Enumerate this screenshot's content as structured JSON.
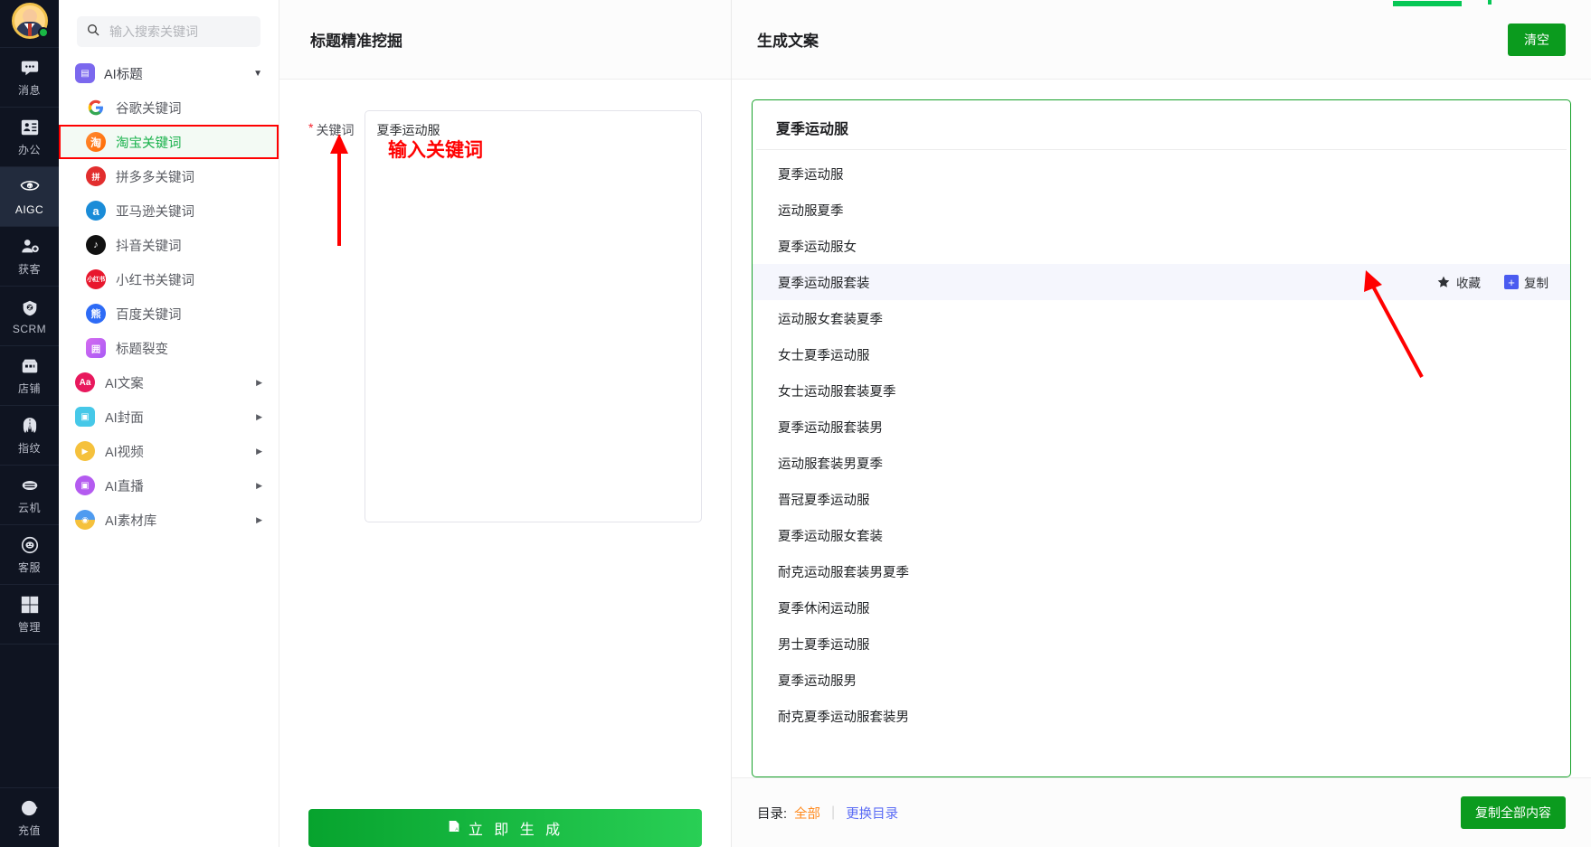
{
  "rail": {
    "avatar_name": "user-avatar",
    "items": [
      {
        "label": "消息",
        "icon": "message-icon",
        "active": false
      },
      {
        "label": "办公",
        "icon": "office-icon",
        "active": false
      },
      {
        "label": "AIGC",
        "icon": "aigc-icon",
        "active": true
      },
      {
        "label": "获客",
        "icon": "customer-acquire-icon",
        "active": false
      },
      {
        "label": "SCRM",
        "icon": "scrm-icon",
        "active": false
      },
      {
        "label": "店铺",
        "icon": "shop-icon",
        "active": false
      },
      {
        "label": "指纹",
        "icon": "fingerprint-icon",
        "active": false
      },
      {
        "label": "云机",
        "icon": "cloud-phone-icon",
        "active": false
      },
      {
        "label": "客服",
        "icon": "support-icon",
        "active": false
      },
      {
        "label": "管理",
        "icon": "manage-icon",
        "active": false
      }
    ],
    "bottom": {
      "label": "充值",
      "icon": "recharge-icon"
    }
  },
  "sidebar": {
    "search": {
      "placeholder": "输入搜索关键词",
      "value": ""
    },
    "group": {
      "label": "AI标题",
      "icon": "ai-title-icon",
      "expanded": true
    },
    "items": [
      {
        "label": "谷歌关键词",
        "icon": "google-icon",
        "selected": false
      },
      {
        "label": "淘宝关键词",
        "icon": "taobao-icon",
        "selected": true
      },
      {
        "label": "拼多多关键词",
        "icon": "pinduoduo-icon",
        "selected": false
      },
      {
        "label": "亚马逊关键词",
        "icon": "amazon-icon",
        "selected": false
      },
      {
        "label": "抖音关键词",
        "icon": "douyin-icon",
        "selected": false
      },
      {
        "label": "小红书关键词",
        "icon": "xiaohongshu-icon",
        "selected": false
      },
      {
        "label": "百度关键词",
        "icon": "baidu-icon",
        "selected": false
      },
      {
        "label": "标题裂变",
        "icon": "title-fission-icon",
        "selected": false
      }
    ],
    "groups": [
      {
        "label": "AI文案",
        "icon": "ai-copywriting-icon"
      },
      {
        "label": "AI封面",
        "icon": "ai-cover-icon"
      },
      {
        "label": "AI视频",
        "icon": "ai-video-icon"
      },
      {
        "label": "AI直播",
        "icon": "ai-live-icon"
      },
      {
        "label": "AI素材库",
        "icon": "ai-asset-library-icon"
      }
    ]
  },
  "middle": {
    "title": "标题精准挖掘",
    "field_label": "关键词",
    "required_mark": "*",
    "keyword_value": "夏季运动服",
    "keyword_placeholder": "",
    "generate_label": "立 即 生 成"
  },
  "annotations": {
    "keyword_hint": "输入关键词"
  },
  "right": {
    "title": "生成文案",
    "clear_label": "清空",
    "result_title": "夏季运动服",
    "results": [
      {
        "text": "夏季运动服",
        "hover": false
      },
      {
        "text": "运动服夏季",
        "hover": false
      },
      {
        "text": "夏季运动服女",
        "hover": false
      },
      {
        "text": "夏季运动服套装",
        "hover": true
      },
      {
        "text": "运动服女套装夏季",
        "hover": false
      },
      {
        "text": "女士夏季运动服",
        "hover": false
      },
      {
        "text": "女士运动服套装夏季",
        "hover": false
      },
      {
        "text": "夏季运动服套装男",
        "hover": false
      },
      {
        "text": "运动服套装男夏季",
        "hover": false
      },
      {
        "text": "晋冠夏季运动服",
        "hover": false
      },
      {
        "text": "夏季运动服女套装",
        "hover": false
      },
      {
        "text": "耐克运动服套装男夏季",
        "hover": false
      },
      {
        "text": "夏季休闲运动服",
        "hover": false
      },
      {
        "text": "男士夏季运动服",
        "hover": false
      },
      {
        "text": "夏季运动服男",
        "hover": false
      },
      {
        "text": "耐克夏季运动服套装男",
        "hover": false
      }
    ],
    "row_actions": {
      "favorite_label": "收藏",
      "copy_label": "复制"
    },
    "footer": {
      "catalog_label": "目录:",
      "catalog_value": "全部",
      "change_catalog": "更换目录",
      "copy_all_label": "复制全部内容"
    }
  },
  "colors": {
    "brand_green": "#0b9b1e",
    "accent_green": "#17a12a",
    "selected_green": "#18b14b",
    "annotation_red": "#ff0000",
    "catalog_orange": "#ff8a1e",
    "link_blue": "#5a6bf5"
  }
}
